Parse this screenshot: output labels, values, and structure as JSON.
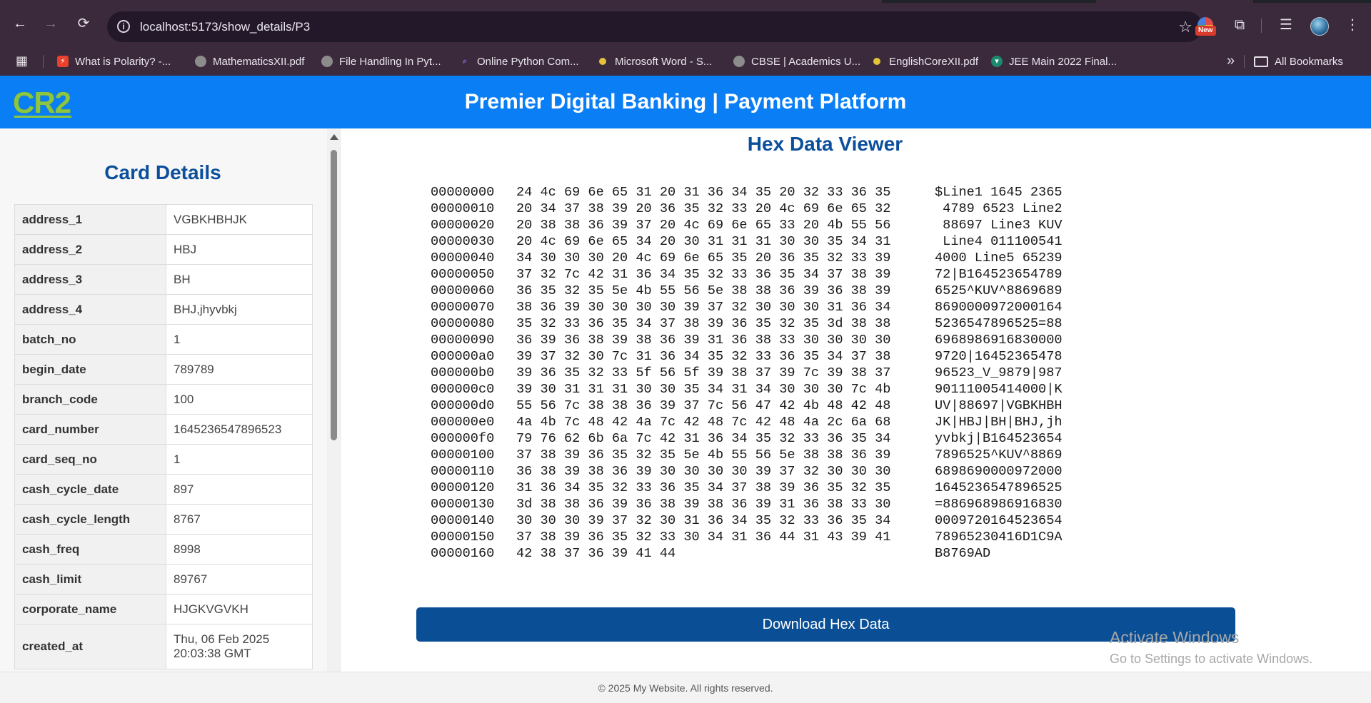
{
  "browser": {
    "url": "localhost:5173/show_details/P3",
    "new_badge": "New",
    "bookmarks": [
      {
        "label": "What is Polarity? -...",
        "icon": "lightning-icon",
        "color": "#e8412c"
      },
      {
        "label": "MathematicsXII.pdf",
        "icon": "globe-icon",
        "color": "#8c8c8c"
      },
      {
        "label": "File Handling In Pyt...",
        "icon": "globe-icon",
        "color": "#8c8c8c"
      },
      {
        "label": "Online Python Com...",
        "icon": "code-icon",
        "color": "#6a4cf0"
      },
      {
        "label": "Microsoft Word - S...",
        "icon": "dot-icon",
        "color": "#e4c33b"
      },
      {
        "label": "CBSE | Academics U...",
        "icon": "globe-icon",
        "color": "#8c8c8c"
      },
      {
        "label": "EnglishCoreXII.pdf",
        "icon": "dot-icon",
        "color": "#e4c33b"
      },
      {
        "label": "JEE Main 2022 Final...",
        "icon": "shield-icon",
        "color": "#1a8a6c"
      }
    ],
    "all_bookmarks": "All Bookmarks"
  },
  "header": {
    "logo": "CR2",
    "title": "Premier Digital Banking | Payment Platform"
  },
  "sidebar": {
    "title": "Card Details",
    "rows": [
      {
        "key": "address_1",
        "value": "VGBKHBHJK"
      },
      {
        "key": "address_2",
        "value": "HBJ"
      },
      {
        "key": "address_3",
        "value": "BH"
      },
      {
        "key": "address_4",
        "value": "BHJ,jhyvbkj"
      },
      {
        "key": "batch_no",
        "value": "1"
      },
      {
        "key": "begin_date",
        "value": "789789"
      },
      {
        "key": "branch_code",
        "value": "100"
      },
      {
        "key": "card_number",
        "value": "1645236547896523"
      },
      {
        "key": "card_seq_no",
        "value": "1"
      },
      {
        "key": "cash_cycle_date",
        "value": "897"
      },
      {
        "key": "cash_cycle_length",
        "value": "8767"
      },
      {
        "key": "cash_freq",
        "value": "8998"
      },
      {
        "key": "cash_limit",
        "value": "89767"
      },
      {
        "key": "corporate_name",
        "value": "HJGKVGVKH"
      },
      {
        "key": "created_at",
        "value": "Thu, 06 Feb 2025 20:03:38 GMT"
      }
    ]
  },
  "hex_viewer": {
    "title": "Hex Data Viewer",
    "rows": [
      {
        "offset": "00000000",
        "bytes": "24 4c 69 6e 65 31 20 31 36 34 35 20 32 33 36 35",
        "ascii": "$Line1 1645 2365"
      },
      {
        "offset": "00000010",
        "bytes": "20 34 37 38 39 20 36 35 32 33 20 4c 69 6e 65 32",
        "ascii": " 4789 6523 Line2"
      },
      {
        "offset": "00000020",
        "bytes": "20 38 38 36 39 37 20 4c 69 6e 65 33 20 4b 55 56",
        "ascii": " 88697 Line3 KUV"
      },
      {
        "offset": "00000030",
        "bytes": "20 4c 69 6e 65 34 20 30 31 31 31 30 30 35 34 31",
        "ascii": " Line4 011100541"
      },
      {
        "offset": "00000040",
        "bytes": "34 30 30 30 20 4c 69 6e 65 35 20 36 35 32 33 39",
        "ascii": "4000 Line5 65239"
      },
      {
        "offset": "00000050",
        "bytes": "37 32 7c 42 31 36 34 35 32 33 36 35 34 37 38 39",
        "ascii": "72|B164523654789"
      },
      {
        "offset": "00000060",
        "bytes": "36 35 32 35 5e 4b 55 56 5e 38 38 36 39 36 38 39",
        "ascii": "6525^KUV^8869689"
      },
      {
        "offset": "00000070",
        "bytes": "38 36 39 30 30 30 30 39 37 32 30 30 30 31 36 34",
        "ascii": "8690000972000164"
      },
      {
        "offset": "00000080",
        "bytes": "35 32 33 36 35 34 37 38 39 36 35 32 35 3d 38 38",
        "ascii": "5236547896525=88"
      },
      {
        "offset": "00000090",
        "bytes": "36 39 36 38 39 38 36 39 31 36 38 33 30 30 30 30",
        "ascii": "6968986916830000"
      },
      {
        "offset": "000000a0",
        "bytes": "39 37 32 30 7c 31 36 34 35 32 33 36 35 34 37 38",
        "ascii": "9720|16452365478"
      },
      {
        "offset": "000000b0",
        "bytes": "39 36 35 32 33 5f 56 5f 39 38 37 39 7c 39 38 37",
        "ascii": "96523_V_9879|987"
      },
      {
        "offset": "000000c0",
        "bytes": "39 30 31 31 31 30 30 35 34 31 34 30 30 30 7c 4b",
        "ascii": "90111005414000|K"
      },
      {
        "offset": "000000d0",
        "bytes": "55 56 7c 38 38 36 39 37 7c 56 47 42 4b 48 42 48",
        "ascii": "UV|88697|VGBKHBH"
      },
      {
        "offset": "000000e0",
        "bytes": "4a 4b 7c 48 42 4a 7c 42 48 7c 42 48 4a 2c 6a 68",
        "ascii": "JK|HBJ|BH|BHJ,jh"
      },
      {
        "offset": "000000f0",
        "bytes": "79 76 62 6b 6a 7c 42 31 36 34 35 32 33 36 35 34",
        "ascii": "yvbkj|B164523654"
      },
      {
        "offset": "00000100",
        "bytes": "37 38 39 36 35 32 35 5e 4b 55 56 5e 38 38 36 39",
        "ascii": "7896525^KUV^8869"
      },
      {
        "offset": "00000110",
        "bytes": "36 38 39 38 36 39 30 30 30 30 39 37 32 30 30 30",
        "ascii": "6898690000972000"
      },
      {
        "offset": "00000120",
        "bytes": "31 36 34 35 32 33 36 35 34 37 38 39 36 35 32 35",
        "ascii": "1645236547896525"
      },
      {
        "offset": "00000130",
        "bytes": "3d 38 38 36 39 36 38 39 38 36 39 31 36 38 33 30",
        "ascii": "=886968986916830"
      },
      {
        "offset": "00000140",
        "bytes": "30 30 30 39 37 32 30 31 36 34 35 32 33 36 35 34",
        "ascii": "0009720164523654"
      },
      {
        "offset": "00000150",
        "bytes": "37 38 39 36 35 32 33 30 34 31 36 44 31 43 39 41",
        "ascii": "78965230416D1C9A"
      },
      {
        "offset": "00000160",
        "bytes": "42 38 37 36 39 41 44",
        "ascii": "B8769AD"
      }
    ],
    "download_label": "Download Hex Data"
  },
  "watermark": {
    "line1": "Activate Windows",
    "line2": "Go to Settings to activate Windows."
  },
  "footer": {
    "text": "© 2025 My Website. All rights reserved."
  }
}
